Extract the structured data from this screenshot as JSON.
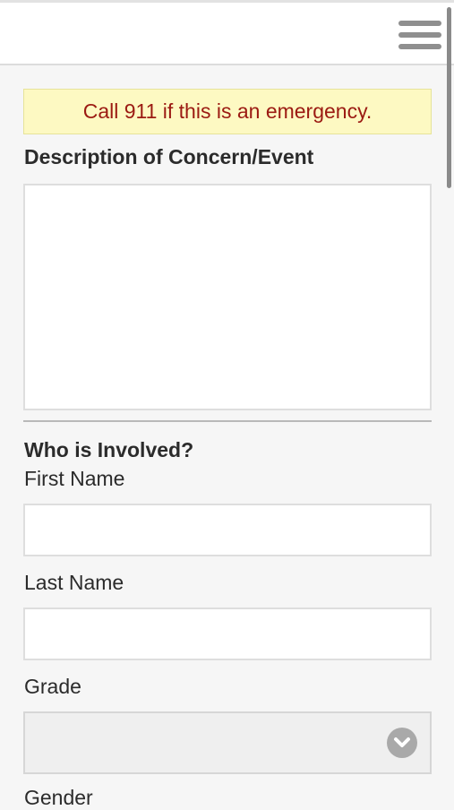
{
  "alert": {
    "text": "Call 911 if this is an emergency."
  },
  "form": {
    "description_label": "Description of Concern/Event",
    "description_value": "",
    "who_involved_heading": "Who is Involved?",
    "first_name_label": "First Name",
    "first_name_value": "",
    "last_name_label": "Last Name",
    "last_name_value": "",
    "grade_label": "Grade",
    "grade_selected": "",
    "gender_label": "Gender"
  },
  "icons": {
    "menu": "hamburger-menu-icon",
    "dropdown": "chevron-down-icon"
  },
  "colors": {
    "alert_background": "#fdf9c2",
    "alert_text": "#9b1a12",
    "page_background": "#f6f6f6"
  }
}
